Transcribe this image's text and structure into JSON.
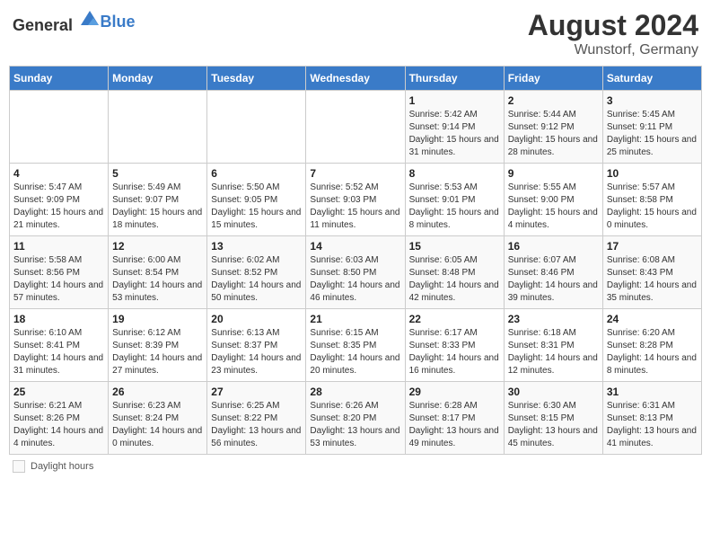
{
  "header": {
    "logo_general": "General",
    "logo_blue": "Blue",
    "month_year": "August 2024",
    "location": "Wunstorf, Germany"
  },
  "legend": {
    "label": "Daylight hours"
  },
  "days_of_week": [
    "Sunday",
    "Monday",
    "Tuesday",
    "Wednesday",
    "Thursday",
    "Friday",
    "Saturday"
  ],
  "weeks": [
    [
      {
        "num": "",
        "detail": ""
      },
      {
        "num": "",
        "detail": ""
      },
      {
        "num": "",
        "detail": ""
      },
      {
        "num": "",
        "detail": ""
      },
      {
        "num": "1",
        "detail": "Sunrise: 5:42 AM\nSunset: 9:14 PM\nDaylight: 15 hours\nand 31 minutes."
      },
      {
        "num": "2",
        "detail": "Sunrise: 5:44 AM\nSunset: 9:12 PM\nDaylight: 15 hours\nand 28 minutes."
      },
      {
        "num": "3",
        "detail": "Sunrise: 5:45 AM\nSunset: 9:11 PM\nDaylight: 15 hours\nand 25 minutes."
      }
    ],
    [
      {
        "num": "4",
        "detail": "Sunrise: 5:47 AM\nSunset: 9:09 PM\nDaylight: 15 hours\nand 21 minutes."
      },
      {
        "num": "5",
        "detail": "Sunrise: 5:49 AM\nSunset: 9:07 PM\nDaylight: 15 hours\nand 18 minutes."
      },
      {
        "num": "6",
        "detail": "Sunrise: 5:50 AM\nSunset: 9:05 PM\nDaylight: 15 hours\nand 15 minutes."
      },
      {
        "num": "7",
        "detail": "Sunrise: 5:52 AM\nSunset: 9:03 PM\nDaylight: 15 hours\nand 11 minutes."
      },
      {
        "num": "8",
        "detail": "Sunrise: 5:53 AM\nSunset: 9:01 PM\nDaylight: 15 hours\nand 8 minutes."
      },
      {
        "num": "9",
        "detail": "Sunrise: 5:55 AM\nSunset: 9:00 PM\nDaylight: 15 hours\nand 4 minutes."
      },
      {
        "num": "10",
        "detail": "Sunrise: 5:57 AM\nSunset: 8:58 PM\nDaylight: 15 hours\nand 0 minutes."
      }
    ],
    [
      {
        "num": "11",
        "detail": "Sunrise: 5:58 AM\nSunset: 8:56 PM\nDaylight: 14 hours\nand 57 minutes."
      },
      {
        "num": "12",
        "detail": "Sunrise: 6:00 AM\nSunset: 8:54 PM\nDaylight: 14 hours\nand 53 minutes."
      },
      {
        "num": "13",
        "detail": "Sunrise: 6:02 AM\nSunset: 8:52 PM\nDaylight: 14 hours\nand 50 minutes."
      },
      {
        "num": "14",
        "detail": "Sunrise: 6:03 AM\nSunset: 8:50 PM\nDaylight: 14 hours\nand 46 minutes."
      },
      {
        "num": "15",
        "detail": "Sunrise: 6:05 AM\nSunset: 8:48 PM\nDaylight: 14 hours\nand 42 minutes."
      },
      {
        "num": "16",
        "detail": "Sunrise: 6:07 AM\nSunset: 8:46 PM\nDaylight: 14 hours\nand 39 minutes."
      },
      {
        "num": "17",
        "detail": "Sunrise: 6:08 AM\nSunset: 8:43 PM\nDaylight: 14 hours\nand 35 minutes."
      }
    ],
    [
      {
        "num": "18",
        "detail": "Sunrise: 6:10 AM\nSunset: 8:41 PM\nDaylight: 14 hours\nand 31 minutes."
      },
      {
        "num": "19",
        "detail": "Sunrise: 6:12 AM\nSunset: 8:39 PM\nDaylight: 14 hours\nand 27 minutes."
      },
      {
        "num": "20",
        "detail": "Sunrise: 6:13 AM\nSunset: 8:37 PM\nDaylight: 14 hours\nand 23 minutes."
      },
      {
        "num": "21",
        "detail": "Sunrise: 6:15 AM\nSunset: 8:35 PM\nDaylight: 14 hours\nand 20 minutes."
      },
      {
        "num": "22",
        "detail": "Sunrise: 6:17 AM\nSunset: 8:33 PM\nDaylight: 14 hours\nand 16 minutes."
      },
      {
        "num": "23",
        "detail": "Sunrise: 6:18 AM\nSunset: 8:31 PM\nDaylight: 14 hours\nand 12 minutes."
      },
      {
        "num": "24",
        "detail": "Sunrise: 6:20 AM\nSunset: 8:28 PM\nDaylight: 14 hours\nand 8 minutes."
      }
    ],
    [
      {
        "num": "25",
        "detail": "Sunrise: 6:21 AM\nSunset: 8:26 PM\nDaylight: 14 hours\nand 4 minutes."
      },
      {
        "num": "26",
        "detail": "Sunrise: 6:23 AM\nSunset: 8:24 PM\nDaylight: 14 hours\nand 0 minutes."
      },
      {
        "num": "27",
        "detail": "Sunrise: 6:25 AM\nSunset: 8:22 PM\nDaylight: 13 hours\nand 56 minutes."
      },
      {
        "num": "28",
        "detail": "Sunrise: 6:26 AM\nSunset: 8:20 PM\nDaylight: 13 hours\nand 53 minutes."
      },
      {
        "num": "29",
        "detail": "Sunrise: 6:28 AM\nSunset: 8:17 PM\nDaylight: 13 hours\nand 49 minutes."
      },
      {
        "num": "30",
        "detail": "Sunrise: 6:30 AM\nSunset: 8:15 PM\nDaylight: 13 hours\nand 45 minutes."
      },
      {
        "num": "31",
        "detail": "Sunrise: 6:31 AM\nSunset: 8:13 PM\nDaylight: 13 hours\nand 41 minutes."
      }
    ]
  ]
}
